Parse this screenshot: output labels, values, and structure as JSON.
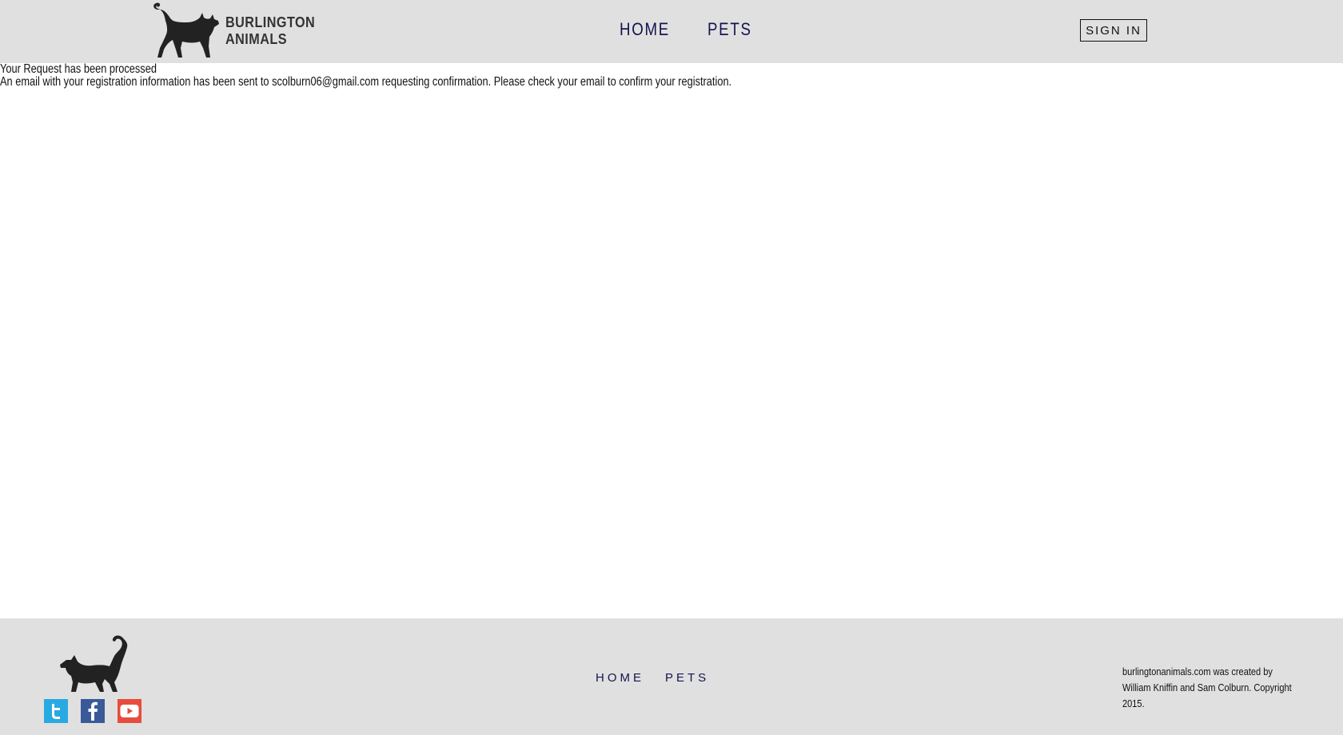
{
  "header": {
    "logo_line1": "BURLINGTON",
    "logo_line2": "ANIMALS",
    "nav": [
      {
        "label": "HOME"
      },
      {
        "label": "PETS"
      }
    ],
    "sign_in": "SIGN IN"
  },
  "main": {
    "title": "Your Request has been processed",
    "message": "An email with your registration information has been sent to scolburn06@gmail.com requesting confirmation. Please check your email to confirm your registration."
  },
  "footer": {
    "social": [
      {
        "icon": "twitter-icon",
        "color": "#29a9e1"
      },
      {
        "icon": "facebook-icon",
        "color": "#3a5998"
      },
      {
        "icon": "youtube-icon",
        "color": "#e74c3c"
      }
    ],
    "nav": [
      {
        "label": "HOME"
      },
      {
        "label": "PETS"
      }
    ],
    "credit": "burlingtonanimals.com was created by William Kniffin and Sam Colburn. Copyright 2015."
  },
  "colors": {
    "header_bg": "#e0e0e0",
    "nav_text": "#14144f",
    "body_bg": "#ffffff"
  }
}
